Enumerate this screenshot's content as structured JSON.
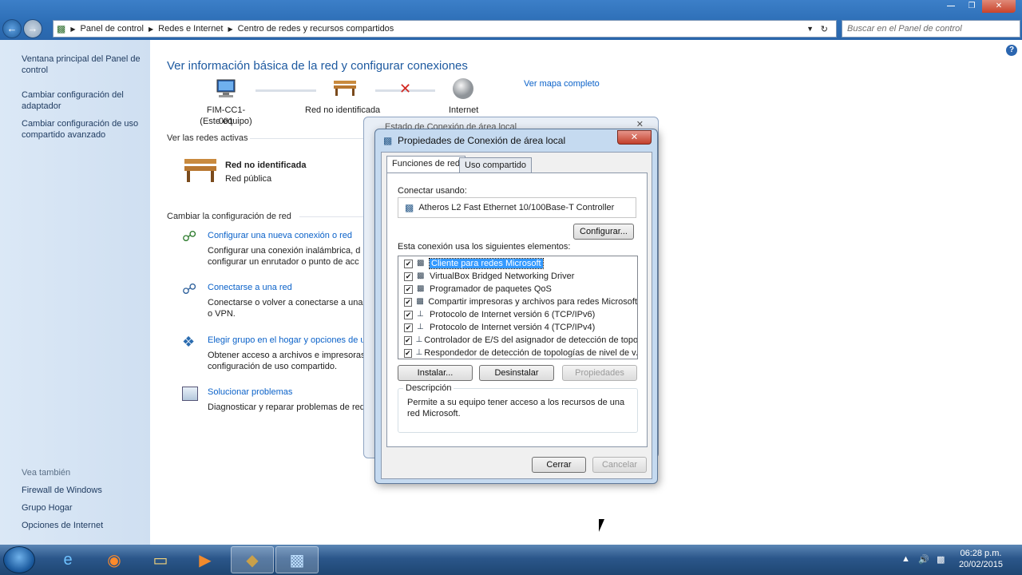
{
  "nav": {
    "back_glyph": "←",
    "forward_glyph": "→",
    "breadcrumbs": [
      "Panel de control",
      "Redes e Internet",
      "Centro de redes y recursos compartidos"
    ],
    "search_placeholder": "Buscar en el Panel de control"
  },
  "sidebar": {
    "links": [
      "Ventana principal del Panel de control",
      "Cambiar configuración del adaptador",
      "Cambiar configuración de uso compartido avanzado"
    ],
    "see_also": "Vea también",
    "see_also_links": [
      "Firewall de Windows",
      "Grupo Hogar",
      "Opciones de Internet"
    ]
  },
  "main": {
    "title": "Ver información básica de la red y configurar conexiones",
    "map_link": "Ver mapa completo",
    "nodes": {
      "computer": "FIM-CC1-001",
      "computer_sub": "(Este equipo)",
      "network": "Red no identificada",
      "internet": "Internet"
    },
    "active_networks_header": "Ver las redes activas",
    "active_network_name": "Red no identificada",
    "active_network_type": "Red pública",
    "change_header": "Cambiar la configuración de red",
    "tasks": [
      {
        "link": "Configurar una nueva conexión o red",
        "desc1": "Configurar una conexión inalámbrica, d",
        "desc2": "configurar un enrutador o punto de acc"
      },
      {
        "link": "Conectarse a una red",
        "desc1": "Conectarse o volver a conectarse a una",
        "desc2": "o VPN."
      },
      {
        "link": "Elegir grupo en el hogar y opciones de u",
        "desc1": "Obtener acceso a archivos e impresoras",
        "desc2": "configuración de uso compartido."
      },
      {
        "link": "Solucionar problemas",
        "desc1": "Diagnosticar y reparar problemas de red",
        "desc2": ""
      }
    ]
  },
  "back_dialog": {
    "title": "Estado de Conexión de área local"
  },
  "dialog": {
    "title": "Propiedades de Conexión de área local",
    "close_glyph": "✕",
    "tabs": [
      "Funciones de red",
      "Uso compartido"
    ],
    "connect_using_label": "Conectar usando:",
    "adapter": "Atheros L2 Fast Ethernet 10/100Base-T Controller",
    "configure_button": "Configurar...",
    "elements_label": "Esta conexión usa los siguientes elementos:",
    "items": [
      {
        "label": "Cliente para redes Microsoft",
        "checked": true
      },
      {
        "label": "VirtualBox Bridged Networking Driver",
        "checked": true
      },
      {
        "label": "Programador de paquetes QoS",
        "checked": true
      },
      {
        "label": "Compartir impresoras y archivos para redes Microsoft",
        "checked": true
      },
      {
        "label": "Protocolo de Internet versión 6 (TCP/IPv6)",
        "checked": true
      },
      {
        "label": "Protocolo de Internet versión 4 (TCP/IPv4)",
        "checked": true
      },
      {
        "label": "Controlador de E/S del asignador de detección de topol...",
        "checked": true
      },
      {
        "label": "Respondedor de detección de topologías de nivel de v...",
        "checked": true
      }
    ],
    "check_glyph": "✔",
    "install_button": "Instalar...",
    "uninstall_button": "Desinstalar",
    "properties_button": "Propiedades",
    "description_legend": "Descripción",
    "description_text": "Permite a su equipo tener acceso a los recursos de una red Microsoft.",
    "close_button": "Cerrar",
    "cancel_button": "Cancelar"
  },
  "taskbar": {
    "time": "06:28 p.m.",
    "date": "20/02/2015"
  },
  "colors": {
    "accent": "#1e5aa0",
    "link": "#0b62c9",
    "sidebar": "#d6e4f4",
    "taskbar": "#2b568a"
  }
}
